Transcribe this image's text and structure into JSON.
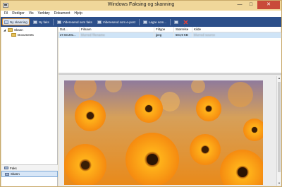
{
  "window": {
    "title": "Windows Faksing og skanning",
    "min_glyph": "—",
    "max_glyph": "□",
    "close_glyph": "✕"
  },
  "menu": [
    "Fil",
    "Rediger",
    "Vis",
    "Verktøy",
    "Dokument",
    "Hjelp"
  ],
  "toolbar": {
    "new_scan": "Ny skanning",
    "new_fax": "Ny faks",
    "forward_fax": "Videresend som faks",
    "forward_email": "Videresend som e-post",
    "save_as": "Lagre som..."
  },
  "sidebar": {
    "root": "Skann",
    "child": "Documents",
    "tabs": [
      "Faks",
      "Skann"
    ]
  },
  "list": {
    "columns": [
      "Dat...",
      "Filnavn",
      "Filtype",
      "Størrelse",
      "Kilde"
    ],
    "rows": [
      {
        "date": "27.03.201...",
        "filename": "blurred filename",
        "type": "jpeg",
        "size": "504,9 KB",
        "source": "blurred source"
      }
    ]
  },
  "preview": {
    "scroll_up": "▲",
    "scroll_down": "▼"
  },
  "colors": {
    "titlebar": "#f0d79a",
    "toolbar": "#2c4f8a",
    "close": "#c94a3a",
    "selection": "#cfe4f7"
  }
}
